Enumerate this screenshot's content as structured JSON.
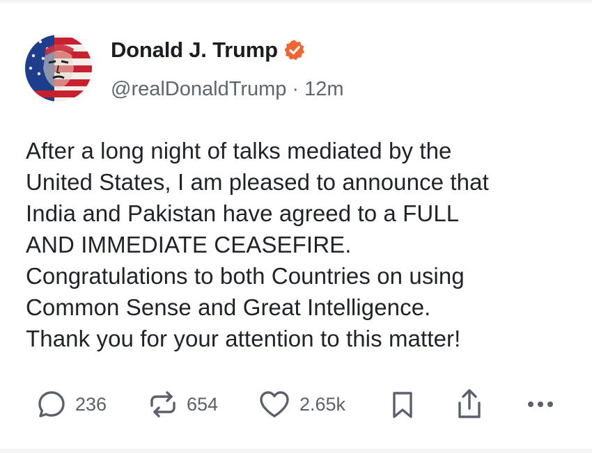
{
  "post": {
    "author": {
      "display_name": "Donald J. Trump",
      "handle": "@realDonaldTrump",
      "verified_icon": "verified-badge-icon",
      "avatar_colors": {
        "red": "#c8202f",
        "white": "#f2f0ea",
        "blue": "#1d3e8c"
      }
    },
    "separator": "·",
    "timestamp": "12m",
    "body_lines": [
      "After a long night of talks mediated by the",
      "United States, I am pleased to announce that",
      "India and Pakistan have agreed to a FULL",
      "AND IMMEDIATE CEASEFIRE.",
      "Congratulations to both Countries on using",
      "Common Sense and Great Intelligence.",
      "Thank you for your attention to this matter!"
    ]
  },
  "actions": {
    "reply": {
      "icon": "reply-icon",
      "count": "236"
    },
    "repost": {
      "icon": "repost-icon",
      "count": "654"
    },
    "like": {
      "icon": "heart-icon",
      "count": "2.65k"
    },
    "bookmark": {
      "icon": "bookmark-icon"
    },
    "share": {
      "icon": "share-icon"
    },
    "more": {
      "icon": "more-icon"
    }
  },
  "colors": {
    "verified_badge": "#f0642f",
    "text_primary": "#1b1d22",
    "text_secondary": "#5d6571",
    "action_gray": "#5a616c"
  }
}
